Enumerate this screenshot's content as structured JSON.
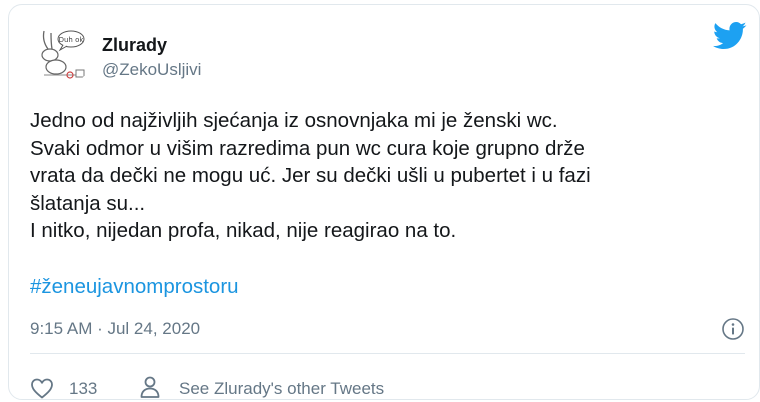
{
  "user": {
    "display_name": "Zlurady",
    "handle": "@ZekoUsljivi",
    "avatar_speech": "Duh ok"
  },
  "tweet": {
    "text": "Jedno od najživljih sjećanja iz osnovnjaka mi je ženski wc.\nSvaki odmor u višim razredima pun wc cura koje grupno drže\nvrata da dečki ne mogu uć. Jer su dečki ušli u pubertet i u fazi\nšlatanja su...\nI nitko, nijedan profa, nikad, nije reagirao na to.",
    "hashtag": "#ženeujavnomprostoru",
    "timestamp": "9:15 AM · Jul 24, 2020"
  },
  "actions": {
    "like_count": "133",
    "other_tweets_label": "See Zlurady's other Tweets"
  },
  "icons": {
    "brand": "twitter-bird-icon",
    "info": "info-icon",
    "like": "heart-icon",
    "profile": "person-icon"
  },
  "colors": {
    "brand_blue": "#1da1f2",
    "link_blue": "#1b95e0",
    "secondary_text": "#657786",
    "border": "#e1e8ed"
  }
}
